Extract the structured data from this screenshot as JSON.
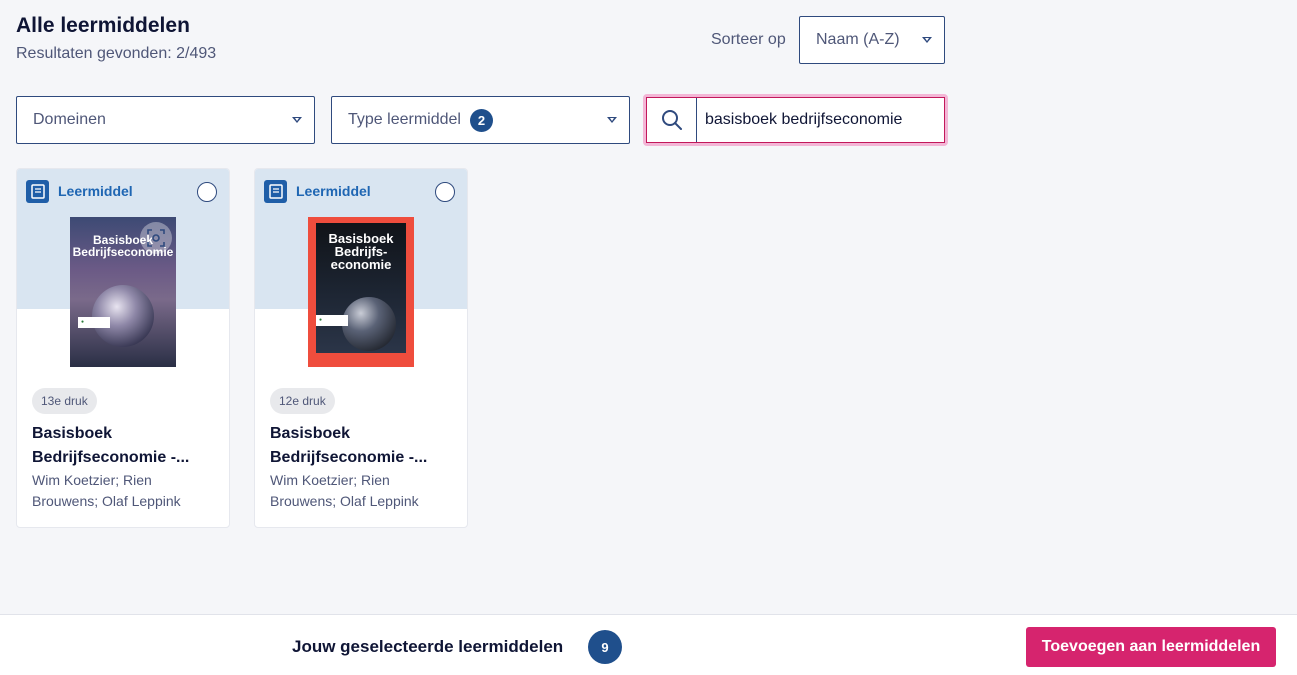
{
  "header": {
    "title": "Alle leermiddelen",
    "results": "Resultaten gevonden: 2/493"
  },
  "sort": {
    "label": "Sorteer op",
    "value": "Naam (A-Z)"
  },
  "filters": {
    "domain": {
      "label": "Domeinen"
    },
    "type": {
      "label": "Type leermiddel",
      "count": "2"
    }
  },
  "search": {
    "value": "basisboek bedrijfseconomie",
    "icon": "search-icon"
  },
  "cards": [
    {
      "type_label": "Leermiddel",
      "cover_title_line1": "Basisboek",
      "cover_title_line2": "Bedrijfseconomie",
      "edition": "13e druk",
      "title": "Basisboek Bedrijfseconomie -...",
      "authors": "Wim Koetzier; Rien Brouwens; Olaf Leppink",
      "cover_color": "#4a4a72"
    },
    {
      "type_label": "Leermiddel",
      "cover_title_line1": "Basisboek",
      "cover_title_line2": "Bedrijfs-",
      "cover_title_line3": "economie",
      "edition": "12e druk",
      "title": "Basisboek Bedrijfseconomie -...",
      "authors": "Wim Koetzier; Rien Brouwens; Olaf Leppink",
      "cover_color": "#ef4d3d"
    }
  ],
  "footer": {
    "selected_label": "Jouw geselecteerde leermiddelen",
    "selected_count": "9",
    "add_button": "Toevoegen aan leermiddelen"
  },
  "colors": {
    "accent": "#d6246e",
    "primary": "#1f4f8c",
    "card_top": "#d9e5f1"
  }
}
